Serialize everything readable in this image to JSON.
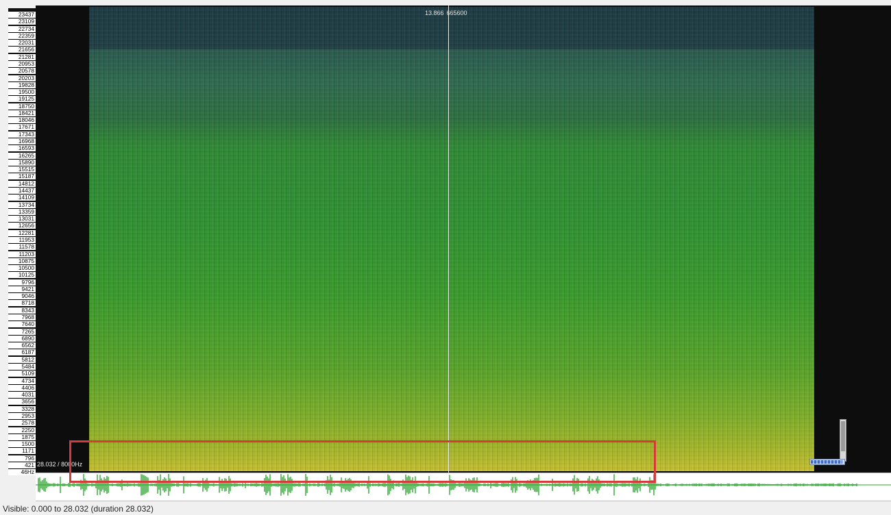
{
  "frequency_axis": {
    "labels": [
      "23437",
      "23109",
      "22734",
      "22359",
      "22031",
      "21656",
      "21281",
      "20953",
      "20578",
      "20203",
      "19828",
      "19500",
      "19125",
      "18750",
      "18421",
      "18046",
      "17671",
      "17343",
      "16968",
      "16593",
      "16265",
      "15890",
      "15515",
      "15187",
      "14812",
      "14437",
      "14109",
      "13734",
      "13359",
      "13031",
      "12656",
      "12281",
      "11953",
      "11578",
      "11203",
      "10875",
      "10500",
      "10125",
      "9796",
      "9421",
      "9046",
      "8718",
      "8343",
      "7968",
      "7640",
      "7265",
      "6890",
      "6562",
      "6187",
      "5812",
      "5484",
      "5109",
      "4734",
      "4406",
      "4031",
      "3656",
      "3328",
      "2953",
      "2578",
      "2250",
      "1875",
      "1500",
      "1171",
      "796",
      "421",
      "46Hz"
    ]
  },
  "cursor": {
    "time": "13.866",
    "value": "665600"
  },
  "view_readout": {
    "duration": "28.032",
    "separator": "/",
    "max_freq": "8000Hz"
  },
  "status": {
    "text": "Visible: 0.000 to 28.032 (duration 28.032)"
  },
  "colors": {
    "highlight_border": "#d63a3a",
    "waveform": "#2fa52f",
    "waveform_center": "#2fa52f",
    "cursor": "#e8f0e8"
  },
  "icons": {
    "vertical_zoom": "vertical-scroll-bar",
    "horizontal_zoom": "horizontal-scroll-mini"
  }
}
